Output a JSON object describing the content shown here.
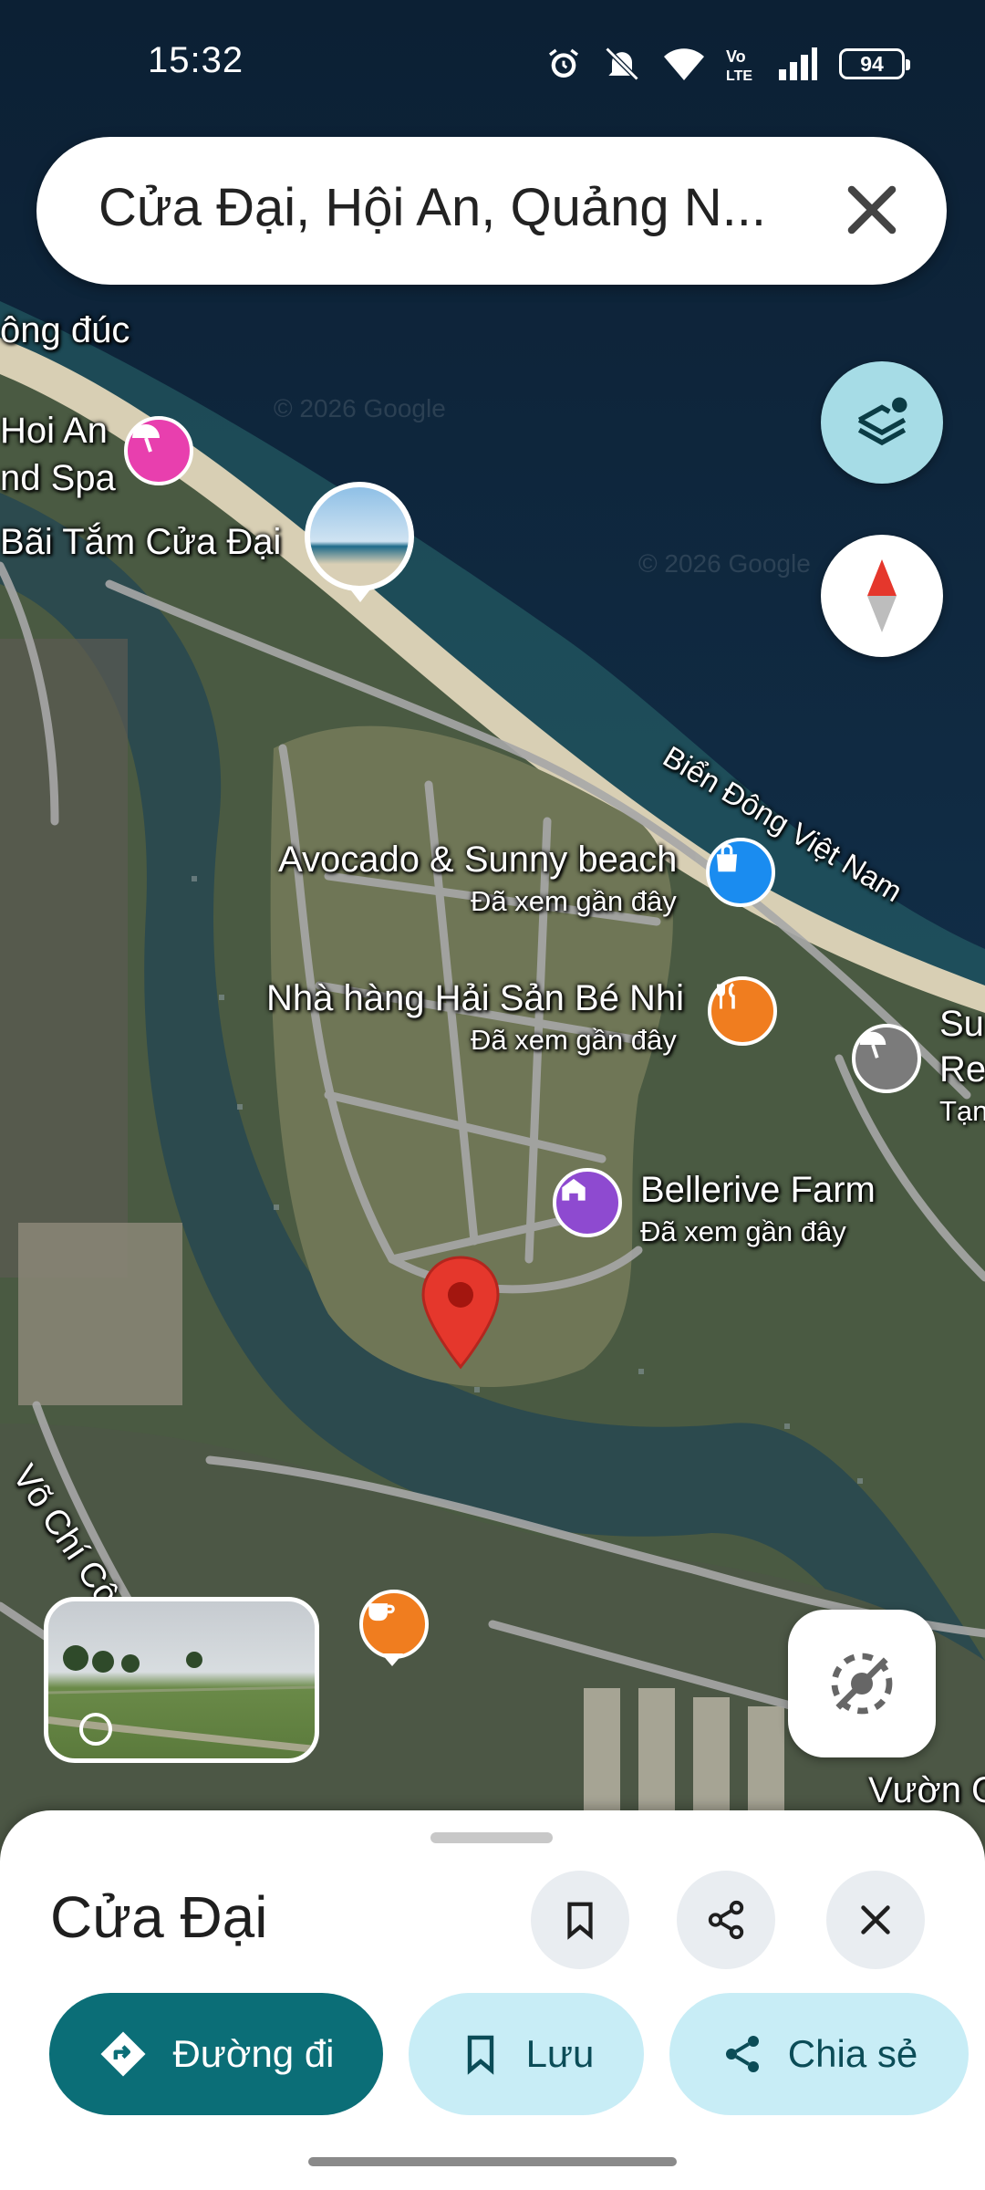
{
  "status_bar": {
    "time": "15:32",
    "battery": "94",
    "icons": [
      "alarm-icon",
      "mute-icon",
      "wifi-icon",
      "volte-icon",
      "signal-icon",
      "battery-icon"
    ]
  },
  "search": {
    "query": "Cửa Đại, Hội An, Quảng N...",
    "clear_icon": "close-icon"
  },
  "map": {
    "labels": {
      "dong_duc": "ông đúc",
      "hoi_an_1": "Hoi An",
      "hoi_an_2": "nd Spa",
      "bai_tam": "Bãi Tắm Cửa Đại",
      "bien_dong": "Biển Đông Việt Nam",
      "avocado": "Avocado & Sunny beach",
      "avocado_sub": "Đã xem gần đây",
      "nha_hang": "Nhà hàng Hải Sản Bé Nhi",
      "nha_hang_sub": "Đã xem gần đây",
      "bellerive": "Bellerive Farm",
      "bellerive_sub": "Đã xem gần đây",
      "su": "Su",
      "re": "Re",
      "tan": "Tạn",
      "vo_chi_cong": "Võ Chí Côn",
      "vuon": "Vườn G"
    },
    "watermark": "© 2026 Google"
  },
  "place": {
    "name": "Cửa Đại"
  },
  "actions": {
    "directions": "Đường đi",
    "save": "Lưu",
    "share": "Chia sẻ"
  },
  "colors": {
    "primary": "#0b6e77",
    "secondary": "#c8edf6",
    "pin_red": "#e5372c",
    "layers_button": "#a6dce6"
  }
}
